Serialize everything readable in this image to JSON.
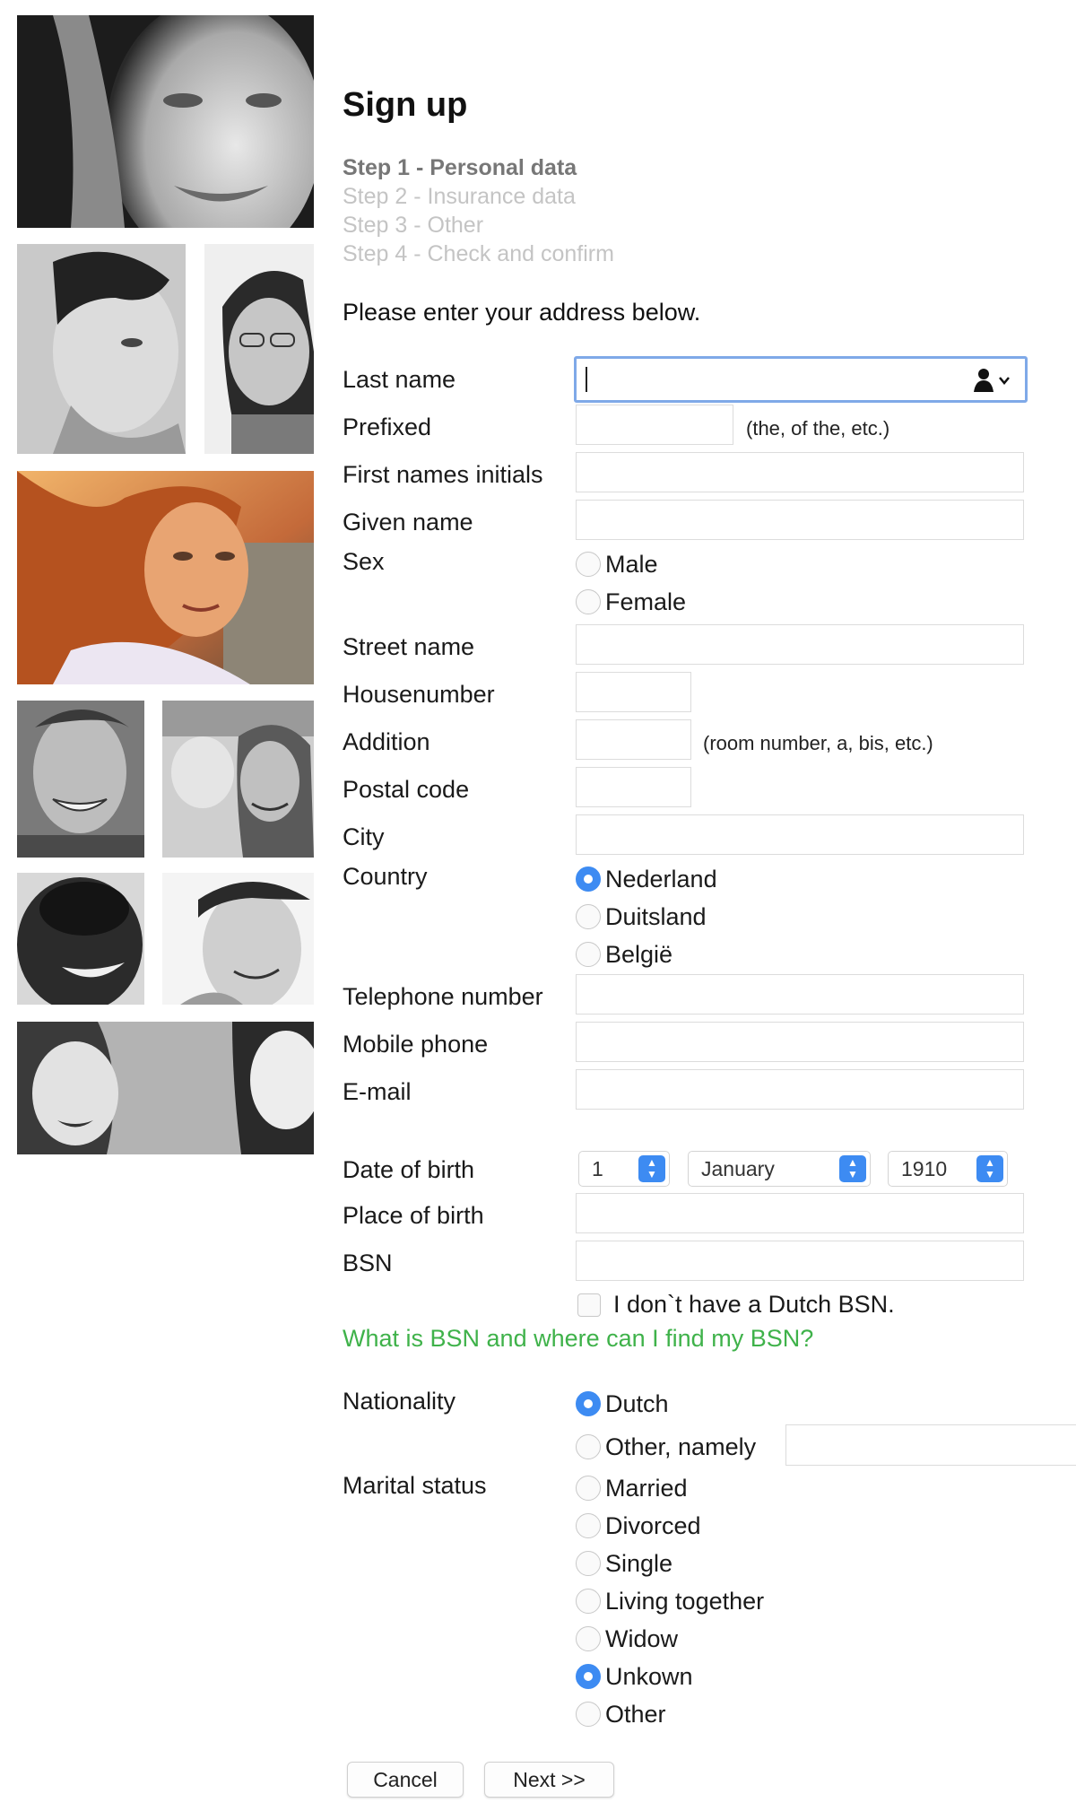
{
  "title": "Sign up",
  "steps": [
    {
      "label": "Step 1 - Personal data",
      "active": true
    },
    {
      "label": "Step 2 - Insurance data",
      "active": false
    },
    {
      "label": "Step 3 - Other",
      "active": false
    },
    {
      "label": "Step 4 - Check and confirm",
      "active": false
    }
  ],
  "intro": "Please enter your address below.",
  "fields": {
    "last_name": {
      "label": "Last name",
      "value": "",
      "icon": "contact-autofill-icon"
    },
    "prefixed": {
      "label": "Prefixed",
      "value": "",
      "hint": "(the, of the, etc.)"
    },
    "first_initials": {
      "label": "First names initials",
      "value": ""
    },
    "given_name": {
      "label": "Given name",
      "value": ""
    },
    "sex": {
      "label": "Sex",
      "options": [
        "Male",
        "Female"
      ],
      "selected": null
    },
    "street": {
      "label": "Street name",
      "value": ""
    },
    "housenumber": {
      "label": "Housenumber",
      "value": ""
    },
    "addition": {
      "label": "Addition",
      "value": "",
      "hint": "(room number, a, bis, etc.)"
    },
    "postal_code": {
      "label": "Postal code",
      "value": ""
    },
    "city": {
      "label": "City",
      "value": ""
    },
    "country": {
      "label": "Country",
      "options": [
        "Nederland",
        "Duitsland",
        "België"
      ],
      "selected": "Nederland"
    },
    "telephone": {
      "label": "Telephone number",
      "value": ""
    },
    "mobile": {
      "label": "Mobile phone",
      "value": ""
    },
    "email": {
      "label": "E-mail",
      "value": ""
    },
    "dob": {
      "label": "Date of birth",
      "day": "1",
      "month": "January",
      "year": "1910"
    },
    "place_of_birth": {
      "label": "Place of birth",
      "value": ""
    },
    "bsn": {
      "label": "BSN",
      "value": "",
      "no_bsn_label": "I don`t have a Dutch BSN.",
      "no_bsn_checked": false
    },
    "bsn_link": "What is BSN and where can I find my BSN?",
    "nationality": {
      "label": "Nationality",
      "options": [
        "Dutch",
        "Other, namely"
      ],
      "selected": "Dutch",
      "other_value": ""
    },
    "marital": {
      "label": "Marital status",
      "options": [
        "Married",
        "Divorced",
        "Single",
        "Living together",
        "Widow",
        "Unkown",
        "Other"
      ],
      "selected": "Unkown"
    }
  },
  "buttons": {
    "cancel": "Cancel",
    "next": "Next >>"
  },
  "colors": {
    "accent": "#3d8bf2",
    "link": "#3fb24a",
    "focus_border": "#7fa9e8",
    "inactive_step": "#c4c4c4"
  }
}
